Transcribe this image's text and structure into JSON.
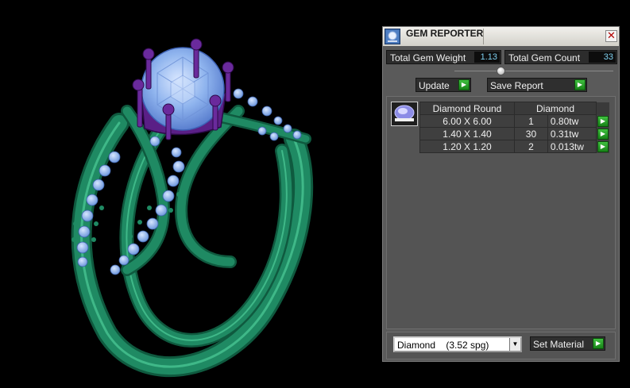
{
  "panel": {
    "title": "GEM REPORTER",
    "close_glyph": "✕",
    "total_weight_label": "Total Gem Weight",
    "total_weight_value": "1.13",
    "total_count_label": "Total Gem Count",
    "total_count_value": "33",
    "update_label": "Update",
    "save_report_label": "Save Report",
    "arrow_glyph": "▶"
  },
  "table": {
    "header": {
      "name": "Diamond Round",
      "material": "Diamond"
    },
    "rows": [
      {
        "size": "6.00 X 6.00",
        "count": "1",
        "weight": "0.80tw"
      },
      {
        "size": "1.40 X 1.40",
        "count": "30",
        "weight": "0.31tw"
      },
      {
        "size": "1.20 X 1.20",
        "count": "2",
        "weight": "0.013tw"
      }
    ]
  },
  "footer": {
    "material_selected": "Diamond    (3.52 spg)",
    "dropdown_glyph": "▼",
    "set_material_label": "Set Material"
  },
  "icons": {
    "app": "gem-app-icon",
    "close": "close-icon",
    "arrow": "play-arrow-icon",
    "dropdown": "chevron-down-icon",
    "thumbnail": "round-diamond-icon"
  },
  "colors": {
    "ring_metal": "#1f8a63",
    "gem_blue": "#8fb4ee",
    "prong_purple": "#6a2a9c",
    "arrow_green": "#2aa82a"
  }
}
